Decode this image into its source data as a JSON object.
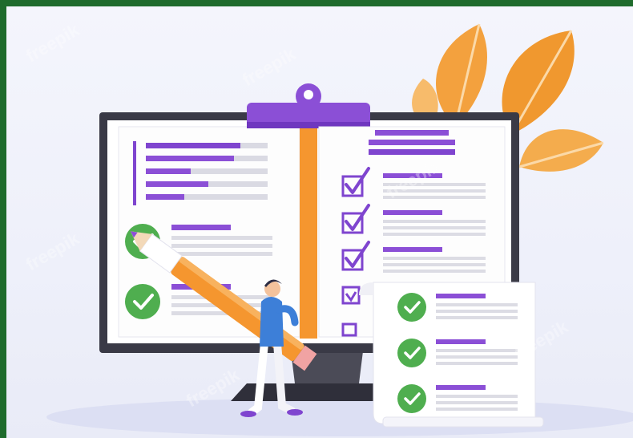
{
  "watermark": {
    "text": "freepik"
  },
  "colors": {
    "accent_purple": "#8b4fd6",
    "check_green": "#4fae4f",
    "orange": "#f5962f",
    "monitor_frame": "#3a3a46",
    "leaf_orange": "#f3a13e"
  },
  "illustration": {
    "left_page": {
      "checked_items": 2,
      "bar_list_rows": 5
    },
    "right_page": {
      "checkbox_items": 5
    },
    "checklist_card": {
      "checked_items": 3
    }
  }
}
